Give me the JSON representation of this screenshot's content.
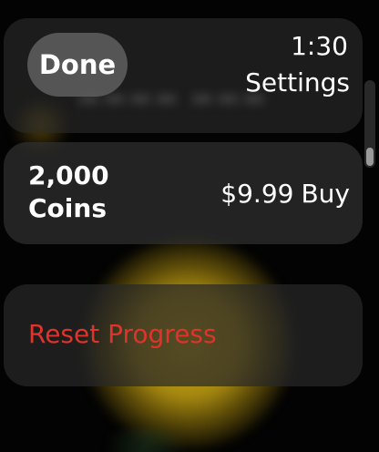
{
  "status_bar": {
    "time": "1:30"
  },
  "nav": {
    "done_label": "Done",
    "title": "Settings"
  },
  "coins_item": {
    "amount": "2,000",
    "unit": "Coins",
    "price": "$9.99",
    "buy_label": "Buy"
  },
  "reset_item": {
    "label": "Reset Progress",
    "color": "#e0332c"
  },
  "theme": {
    "background": "#000000",
    "accent_destructive": "#e0332c"
  }
}
